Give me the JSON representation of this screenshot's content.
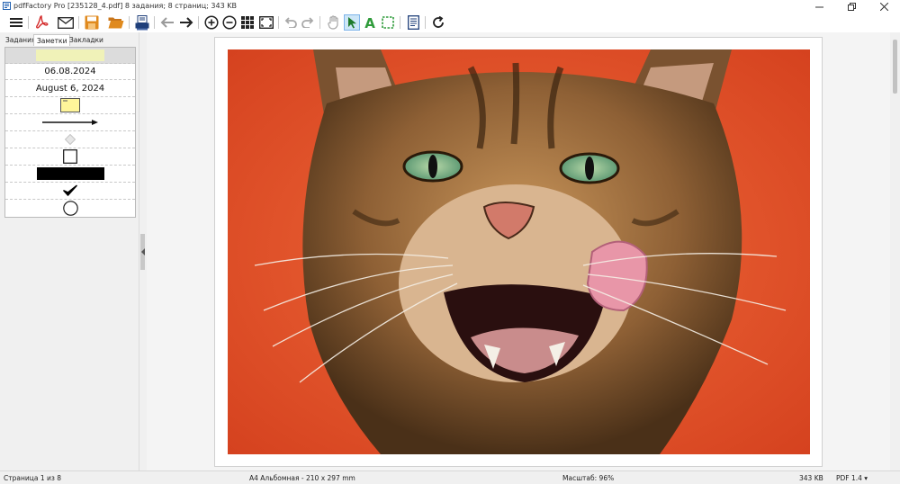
{
  "window": {
    "title": "pdfFactory Pro [235128_4.pdf] 8 задания; 8 страниц; 343 KB"
  },
  "toolbar": {
    "buttons": [
      "menu-icon",
      "pdf-icon",
      "email-icon",
      "save-icon",
      "open-folder-icon",
      "print-icon",
      "back-arrow-icon",
      "forward-arrow-icon",
      "zoom-in-icon",
      "zoom-out-icon",
      "thumbnails-icon",
      "fit-page-icon",
      "undo-icon",
      "redo-icon",
      "hand-icon",
      "select-arrow-icon",
      "text-tool-icon",
      "crop-select-icon",
      "notes-icon",
      "refresh-icon"
    ]
  },
  "tabs": [
    "Задания",
    "Заметки",
    "Закладки"
  ],
  "active_tab": "Заметки",
  "notes": {
    "date_short": "06.08.2024",
    "date_long": "August 6, 2024",
    "items": [
      "highlight-note",
      "date-stamp-short",
      "date-stamp-long",
      "sticky-note-icon",
      "arrow-line-icon",
      "diamond-icon",
      "square-icon",
      "black-bar-icon",
      "checkmark-icon",
      "circle-icon"
    ]
  },
  "document": {
    "image": "cat licking lips on orange background"
  },
  "status": {
    "page": "Страница 1 из 8",
    "paper": "A4 Альбомная - 210 x 297 mm",
    "zoom": "Масштаб: 96%",
    "size": "343 KB",
    "pdf_version": "PDF 1.4 ▾"
  },
  "colors": {
    "accent_green": "#2e9b3a",
    "save_orange": "#e08a1e",
    "pdf_red": "#d42b2b",
    "photo_bg": "#e5502a"
  }
}
